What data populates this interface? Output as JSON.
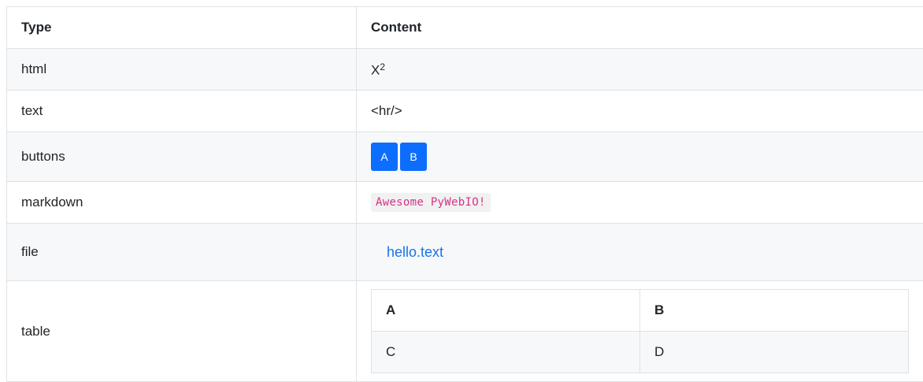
{
  "header": {
    "type_label": "Type",
    "content_label": "Content"
  },
  "rows": {
    "html": {
      "type": "html",
      "base": "X",
      "superscript": "2"
    },
    "text": {
      "type": "text",
      "content": "<hr/>"
    },
    "buttons": {
      "type": "buttons",
      "items": [
        "A",
        "B"
      ],
      "color": "#0d6efd"
    },
    "markdown": {
      "type": "markdown",
      "code": "Awesome PyWebIO!",
      "code_color": "#d63384"
    },
    "file": {
      "type": "file",
      "link": "hello.text",
      "link_color": "#1a73e8"
    },
    "table": {
      "type": "table",
      "headers": [
        "A",
        "B"
      ],
      "cells": [
        "C",
        "D"
      ]
    }
  }
}
